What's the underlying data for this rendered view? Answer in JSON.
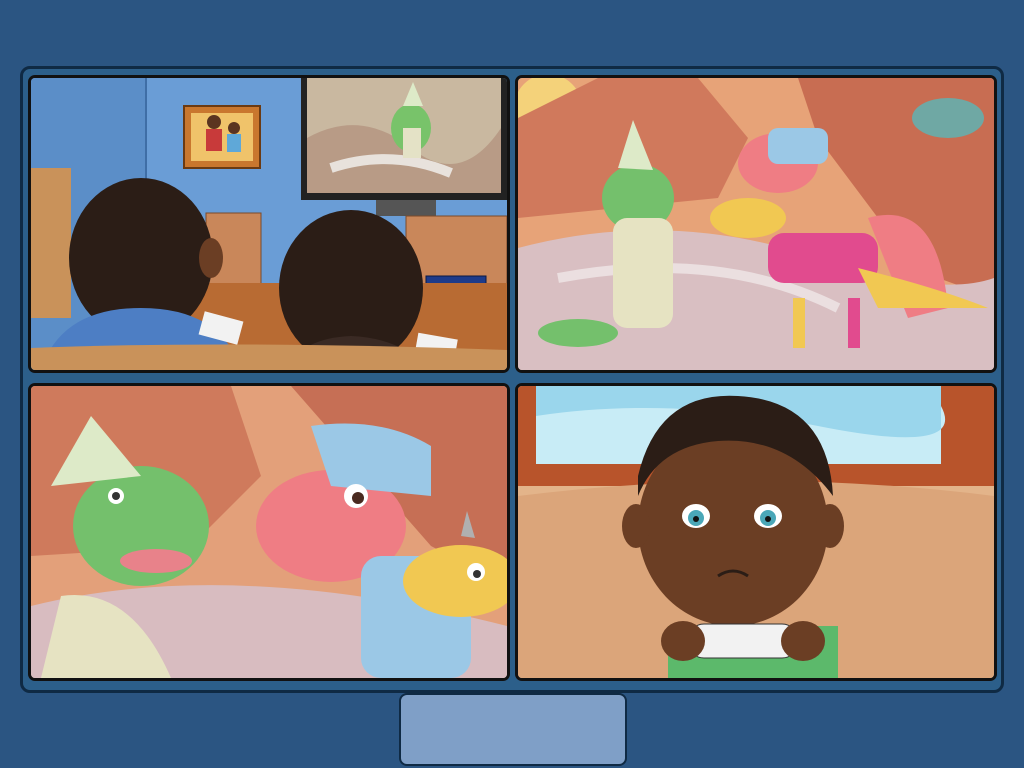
{
  "comic": {
    "panels": [
      {
        "scene": "living-room"
      },
      {
        "scene": "canyon-dinosaurs"
      },
      {
        "scene": "canyon-closeup"
      },
      {
        "scene": "boy-playing"
      }
    ]
  },
  "controls": {
    "next_label": ""
  },
  "colors": {
    "background": "#2b5582",
    "frame": "#2c5f8a",
    "button": "#7f9fc7"
  }
}
